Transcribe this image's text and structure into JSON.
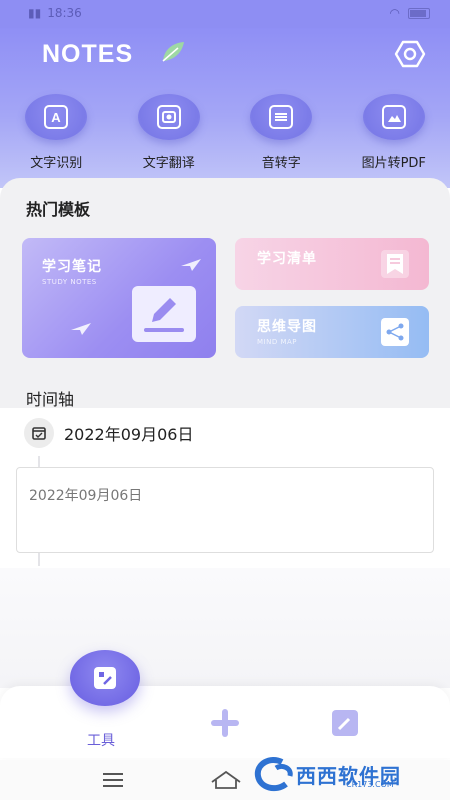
{
  "status_bar": {
    "time": "18:36"
  },
  "header": {
    "app_title": "NOTES"
  },
  "tools": [
    {
      "label": "文字识别",
      "icon": "text-recognition-icon"
    },
    {
      "label": "文字翻译",
      "icon": "camera-translate-icon"
    },
    {
      "label": "音转字",
      "icon": "audio-to-text-icon"
    },
    {
      "label": "图片转PDF",
      "icon": "image-to-pdf-icon"
    }
  ],
  "templates": {
    "title": "热门模板",
    "items": [
      {
        "title": "学习笔记",
        "subtitle": "STUDY NOTES",
        "icon": "pad-pen-icon",
        "colors": [
          "#c2baf7",
          "#8f80ee"
        ]
      },
      {
        "title": "学习清单",
        "subtitle": "",
        "icon": "bookmark-icon",
        "colors": [
          "#f8d2e4",
          "#f7a9c9"
        ]
      },
      {
        "title": "思维导图",
        "subtitle": "MIND MAP",
        "icon": "mind-map-icon",
        "colors": [
          "#c9d3f5",
          "#8fb7f2"
        ]
      }
    ]
  },
  "timeline": {
    "title": "时间轴",
    "date": "2022年09月06日",
    "entries": [
      {
        "text": "2022年09月06日"
      }
    ]
  },
  "bottom_nav": {
    "tools_label": "工具",
    "add_icon": "plus-icon",
    "note_icon": "edit-note-icon"
  },
  "watermark": {
    "text": "西西软件园",
    "sub": "CR173.COM"
  },
  "colors": {
    "accent": "#7b7be8",
    "header_top": "#8f8ff5",
    "nav_accent": "#6a5fd8"
  }
}
